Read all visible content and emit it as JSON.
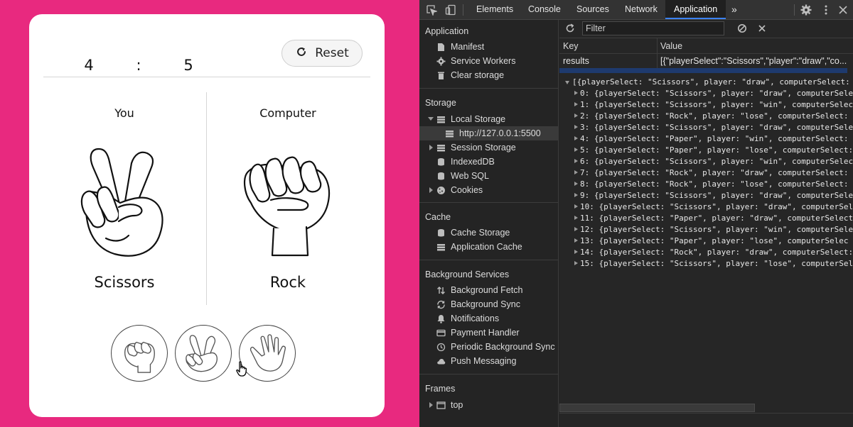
{
  "game": {
    "score_you": "4",
    "score_separator": ":",
    "score_cpu": "5",
    "reset_label": "Reset",
    "you_label": "You",
    "cpu_label": "Computer",
    "you_choice": "Scissors",
    "cpu_choice": "Rock",
    "choices": [
      "rock",
      "scissors",
      "paper"
    ]
  },
  "colors": {
    "page_background": "#e8297f",
    "card_background": "#ffffff",
    "devtools_background": "#242424",
    "devtools_accent": "#3b82f6"
  },
  "devtools": {
    "tabs": [
      "Elements",
      "Console",
      "Sources",
      "Network",
      "Application"
    ],
    "active_tab": "Application",
    "more_tabs": "»",
    "sidebar": {
      "sections": [
        {
          "title": "Application",
          "items": [
            "Manifest",
            "Service Workers",
            "Clear storage"
          ]
        },
        {
          "title": "Storage",
          "items": [
            "Local Storage",
            "http://127.0.0.1:5500",
            "Session Storage",
            "IndexedDB",
            "Web SQL",
            "Cookies"
          ]
        },
        {
          "title": "Cache",
          "items": [
            "Cache Storage",
            "Application Cache"
          ]
        },
        {
          "title": "Background Services",
          "items": [
            "Background Fetch",
            "Background Sync",
            "Notifications",
            "Payment Handler",
            "Periodic Background Sync",
            "Push Messaging"
          ]
        },
        {
          "title": "Frames",
          "items": [
            "top"
          ]
        }
      ]
    },
    "filter_placeholder": "Filter",
    "table": {
      "headers": [
        "Key",
        "Value"
      ],
      "rows": [
        {
          "key": "results",
          "value": "[{\"playerSelect\":\"Scissors\",\"player\":\"draw\",\"co..."
        }
      ]
    },
    "json_preview": {
      "root": "[{playerSelect: \"Scissors\", player: \"draw\", computerSelect:",
      "entries": [
        "0: {playerSelect: \"Scissors\", player: \"draw\", computerSele",
        "1: {playerSelect: \"Scissors\", player: \"win\", computerSelec",
        "2: {playerSelect: \"Rock\", player: \"lose\", computerSelect: ",
        "3: {playerSelect: \"Scissors\", player: \"draw\", computerSele",
        "4: {playerSelect: \"Paper\", player: \"win\", computerSelect: ",
        "5: {playerSelect: \"Paper\", player: \"lose\", computerSelect:",
        "6: {playerSelect: \"Scissors\", player: \"win\", computerSelec",
        "7: {playerSelect: \"Rock\", player: \"draw\", computerSelect: ",
        "8: {playerSelect: \"Rock\", player: \"lose\", computerSelect: ",
        "9: {playerSelect: \"Scissors\", player: \"draw\", computerSele",
        "10: {playerSelect: \"Scissors\", player: \"draw\", computerSel",
        "11: {playerSelect: \"Paper\", player: \"draw\", computerSelect",
        "12: {playerSelect: \"Scissors\", player: \"win\", computerSele",
        "13: {playerSelect: \"Paper\", player: \"lose\", computerSelec",
        "14: {playerSelect: \"Rock\", player: \"draw\", computerSelect:",
        "15: {playerSelect: \"Scissors\", player: \"lose\", computerSel"
      ]
    }
  }
}
